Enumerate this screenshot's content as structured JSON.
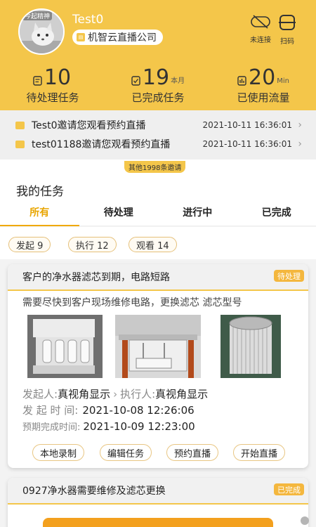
{
  "header": {
    "avatar_badge": "今起精神",
    "username": "Test0",
    "company": "机智云直播公司",
    "company_icon": "building-icon",
    "actions": [
      {
        "label": "未连接",
        "icon": "disconnected-icon"
      },
      {
        "label": "扫码",
        "icon": "scan-icon"
      }
    ],
    "stats": [
      {
        "value": "10",
        "unit": "",
        "label": "待处理任务",
        "icon": "pending-task-icon"
      },
      {
        "value": "19",
        "unit": "本月",
        "label": "已完成任务",
        "icon": "done-task-icon"
      },
      {
        "value": "20",
        "unit": "Min",
        "label": "已使用流量",
        "icon": "traffic-icon"
      }
    ],
    "accent_color": "#f4c64a"
  },
  "notices": [
    {
      "text": "Test0邀请您观看预约直播",
      "time": "2021-10-11 16:36:01"
    },
    {
      "text": "test01188邀请您观看预约直播",
      "time": "2021-10-11 16:36:01"
    }
  ],
  "more_invites": "其他1998条邀请",
  "tasks": {
    "title": "我的任务",
    "tabs": [
      "所有",
      "待处理",
      "进行中",
      "已完成"
    ],
    "active_tab": "所有",
    "filters": [
      "发起 9",
      "执行 12",
      "观看 14"
    ]
  },
  "cards": [
    {
      "title": "客户的净水器滤芯到期，电路短路",
      "status": "待处理",
      "description": "需要尽快到客户现场维修电路，更换滤芯 滤芯型号",
      "initiator_label": "发起人:",
      "initiator": "真视角显示",
      "executor_label": "执行人:",
      "executor": "真视角显示",
      "start_label": "发 起 时 间:",
      "start_time": "2021-10-08 12:26:06",
      "due_label": "预期完成时间:",
      "due_time": "2021-10-09 12:23:00",
      "buttons": [
        "本地录制",
        "编辑任务",
        "预约直播",
        "开始直播"
      ]
    },
    {
      "title": "0927净水器需要维修及滤芯更换",
      "status": "已完成"
    }
  ]
}
